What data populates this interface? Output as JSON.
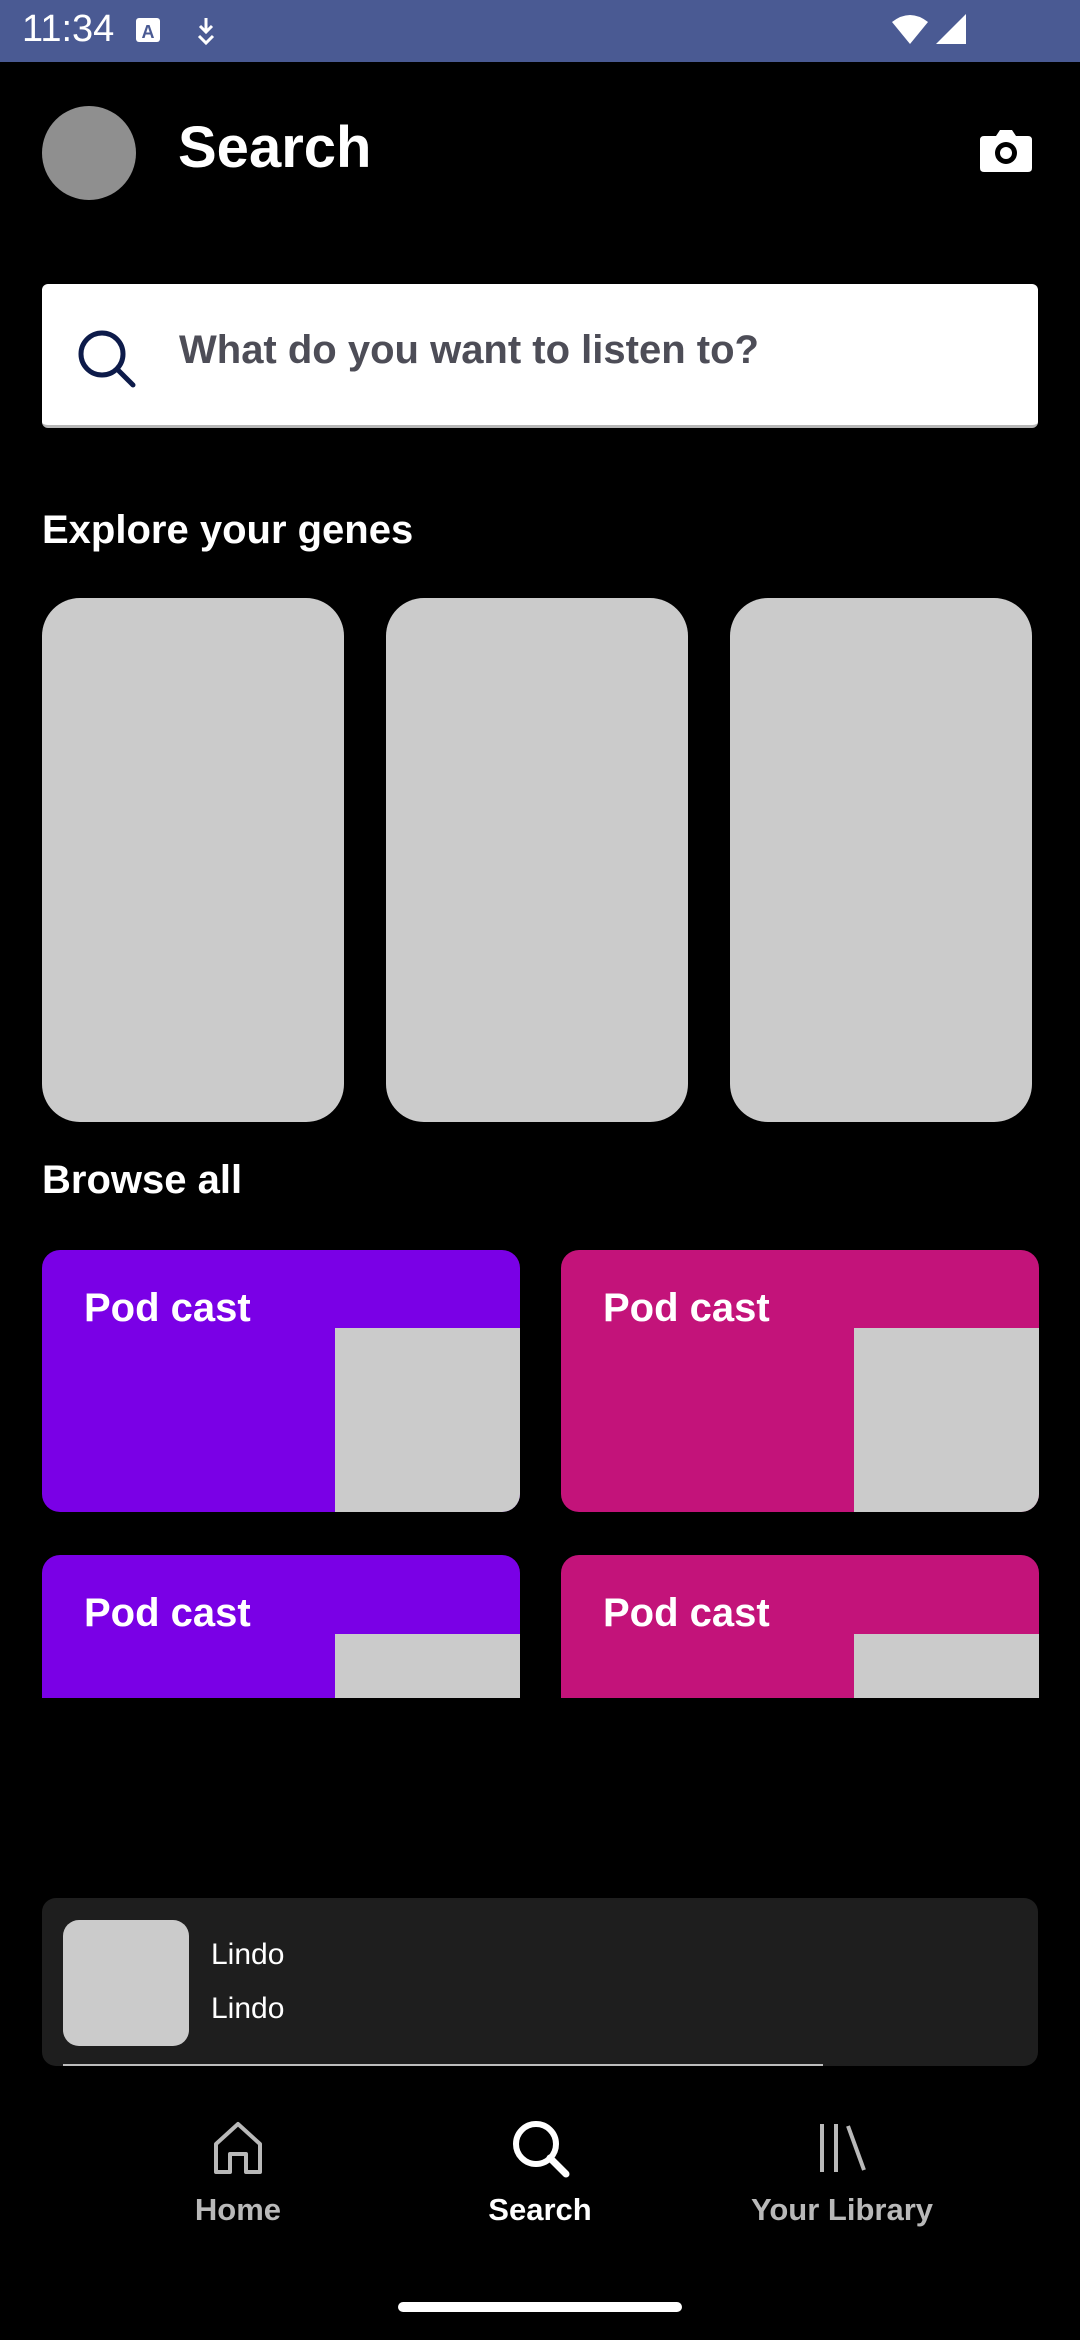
{
  "status_bar": {
    "time": "11:34",
    "icons": [
      "keyboard-a-icon",
      "download-icon",
      "wifi-icon",
      "signal-icon"
    ]
  },
  "header": {
    "title": "Search",
    "camera_icon": "camera-icon"
  },
  "search": {
    "placeholder": "What do you want to listen to?",
    "icon": "search-icon"
  },
  "explore": {
    "title": "Explore your genes",
    "cards": 3
  },
  "browse": {
    "title": "Browse all",
    "cards": [
      {
        "label": "Pod cast",
        "color": "#7a00e6"
      },
      {
        "label": "Pod cast",
        "color": "#c3137a"
      },
      {
        "label": "Pod cast",
        "color": "#7a00e6"
      },
      {
        "label": "Pod cast",
        "color": "#c3137a"
      }
    ]
  },
  "now_playing": {
    "title": "Lindo",
    "artist": "Lindo"
  },
  "nav": {
    "items": [
      {
        "label": "Home",
        "icon": "home-icon",
        "active": false
      },
      {
        "label": "Search",
        "icon": "search-icon",
        "active": true
      },
      {
        "label": "Your Library",
        "icon": "library-icon",
        "active": false
      }
    ]
  }
}
